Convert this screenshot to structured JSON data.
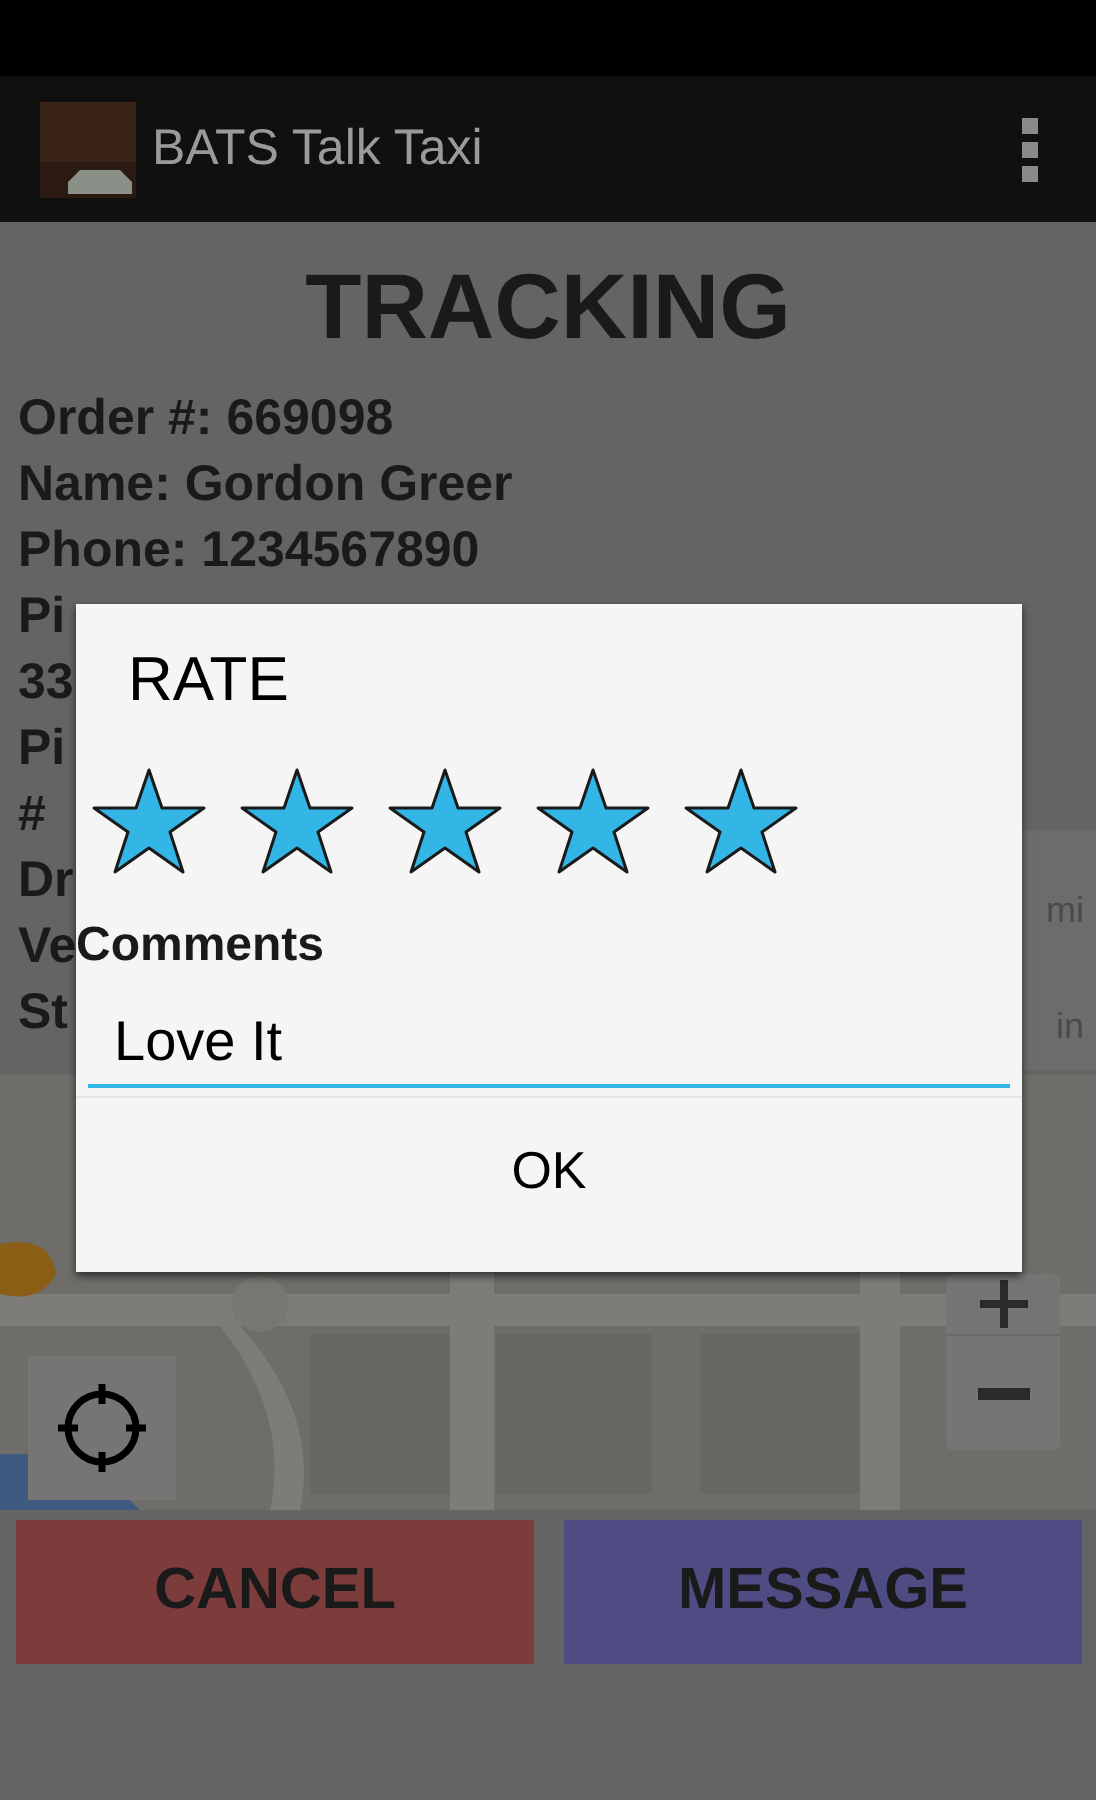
{
  "app_bar": {
    "title": "BATS Talk Taxi"
  },
  "heading": "TRACKING",
  "details": [
    "Order #: 669098",
    "Name: Gordon Greer",
    "Phone: 1234567890",
    "Pi",
    "33",
    "Pi",
    "#",
    "Dr",
    "Ve",
    "St"
  ],
  "side_panel": {
    "unit_1": "mi",
    "unit_2": "in"
  },
  "buttons": [
    {
      "label": "CANCEL",
      "kind": "cancel"
    },
    {
      "label": "MESSAGE",
      "kind": "message"
    }
  ],
  "dialog": {
    "title": "RATE",
    "stars": 5,
    "comments_label": "Comments",
    "comment": {
      "value": "Love It"
    },
    "ok": "OK"
  }
}
